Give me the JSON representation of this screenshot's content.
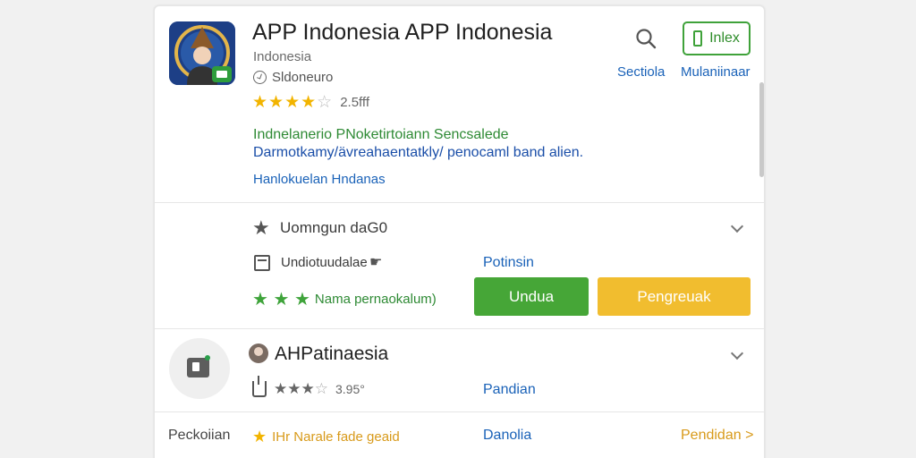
{
  "header": {
    "title": "APP Indonesia APP Indonesia",
    "subtitle": "Indonesia",
    "developer": "Sldoneuro",
    "rating_count": "2.5fff",
    "stars": "★★★★",
    "half_star": "☆",
    "search_label": "Sectiola",
    "install_button_label": "Inlex",
    "install_label": "Mulaniinaar",
    "description_line1": "Indnelanerio PNoketirtoiann Sencsalede",
    "description_line2": "Darmotkamy/ävreahaentatkly/ penocaml band alien.",
    "link": "Hanlokuelan Hndanas"
  },
  "section2": {
    "title": "Uomngun daG0",
    "subtitle": "Undiotuudalae",
    "link": "Potinsin",
    "stars_label": "Nama pernaokalum)",
    "green_button": "Undua",
    "yellow_button": "Pengreuak"
  },
  "section3": {
    "title": "AHPatinaesia",
    "rating_count": "3.95°",
    "link": "Pandian"
  },
  "bottom_row": {
    "left": "Peckoiian",
    "middle": "IHr Narale fade geaid",
    "link": "Danolia",
    "right": "Pendidan >"
  },
  "colors": {
    "accent_blue": "#1a62b8",
    "green": "#46a637",
    "yellow": "#f1bd2f",
    "star": "#f2b400"
  }
}
